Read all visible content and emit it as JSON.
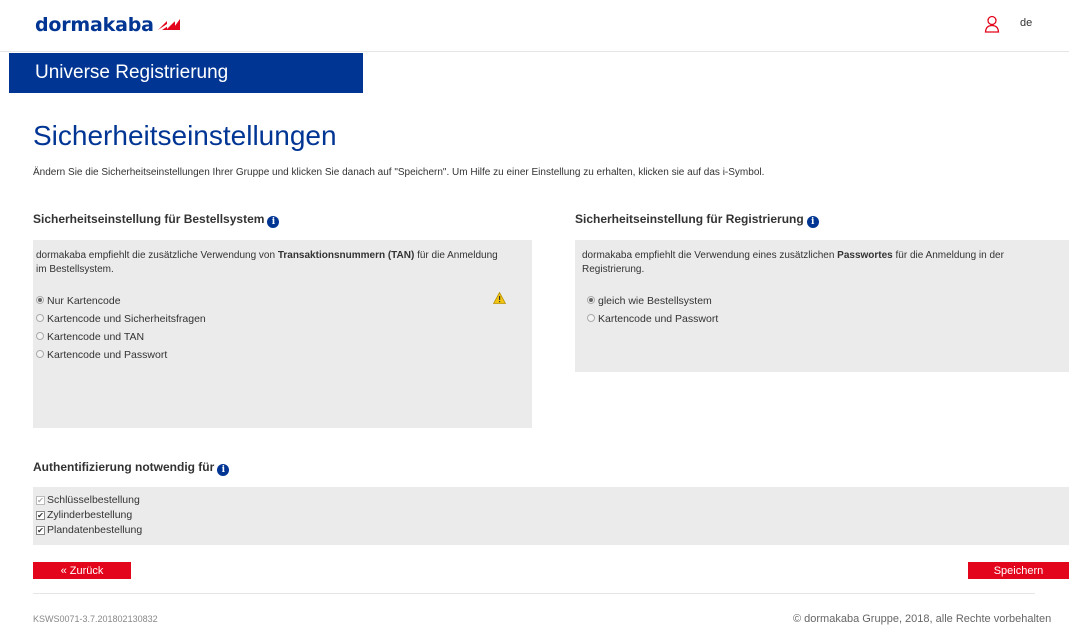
{
  "header": {
    "logo_text": "dormakaba",
    "language": "de",
    "banner_title": "Universe Registrierung"
  },
  "page": {
    "title": "Sicherheitseinstellungen",
    "intro": "Ändern Sie die Sicherheitseinstellungen Ihrer Gruppe und klicken Sie danach auf \"Speichern\". Um Hilfe zu einer Einstellung zu erhalten, klicken sie auf das i-Symbol."
  },
  "bestellsystem": {
    "title": "Sicherheitseinstellung für Bestellsystem",
    "text_before": "dormakaba empfiehlt die zusätzliche Verwendung von ",
    "text_bold": "Transaktionsnummern (TAN)",
    "text_after": " für die Anmeldung im Bestellsystem.",
    "options": [
      "Nur Kartencode",
      "Kartencode und Sicherheitsfragen",
      "Kartencode und TAN",
      "Kartencode und Passwort"
    ],
    "selected": "Nur Kartencode"
  },
  "registrierung": {
    "title": "Sicherheitseinstellung für Registrierung",
    "text_before": "dormakaba empfiehlt die Verwendung eines zusätzlichen ",
    "text_bold": "Passwortes",
    "text_after": " für die Anmeldung in der Registrierung.",
    "options": [
      "gleich wie Bestellsystem",
      "Kartencode und Passwort"
    ],
    "selected": "gleich wie Bestellsystem"
  },
  "auth": {
    "title": "Authentifizierung notwendig für",
    "items": [
      {
        "label": "Schlüsselbestellung",
        "checked": true,
        "disabled": true
      },
      {
        "label": "Zylinderbestellung",
        "checked": true,
        "disabled": false
      },
      {
        "label": "Plandatenbestellung",
        "checked": true,
        "disabled": false
      }
    ]
  },
  "buttons": {
    "back": "« Zurück",
    "save": "Speichern"
  },
  "footer": {
    "version": "KSWS0071-3.7.201802130832",
    "copyright": "© dormakaba Gruppe, 2018, alle Rechte vorbehalten"
  },
  "colors": {
    "brand_blue": "#003594",
    "brand_red": "#e3051b",
    "panel_gray": "#ebebeb"
  },
  "icons": [
    "dormakaba-logo-mark",
    "user-icon",
    "info-icon",
    "warning-icon",
    "radio",
    "checkbox"
  ]
}
